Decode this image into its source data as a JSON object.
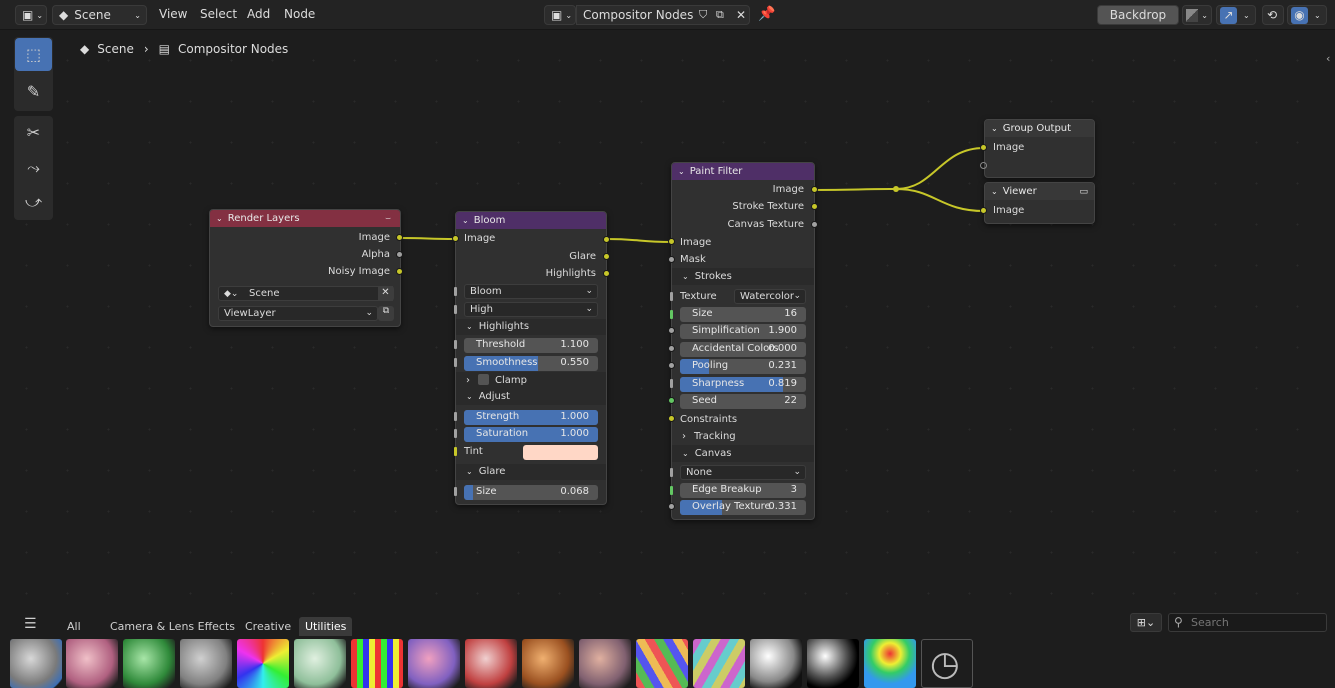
{
  "topbar": {
    "scene": "Scene",
    "menus": [
      "View",
      "Select",
      "Add",
      "Node"
    ],
    "tree_name": "Compositor Nodes",
    "backdrop": "Backdrop"
  },
  "breadcrumb": {
    "scene": "Scene",
    "tree": "Compositor Nodes"
  },
  "nodes": {
    "render_layers": {
      "title": "Render Layers",
      "outputs": [
        "Image",
        "Alpha",
        "Noisy Image"
      ],
      "scene": "Scene",
      "view_layer": "ViewLayer",
      "color": "#833042"
    },
    "bloom": {
      "title": "Bloom",
      "input": "Image",
      "outputs": [
        "Glare",
        "Highlights"
      ],
      "type": "Bloom",
      "quality": "High",
      "highlights_panel": "Highlights",
      "threshold_label": "Threshold",
      "threshold": "1.100",
      "smoothness_label": "Smoothness",
      "smoothness": "0.550",
      "smoothness_fill": 0.55,
      "clamp": "Clamp",
      "adjust_panel": "Adjust",
      "strength_label": "Strength",
      "strength": "1.000",
      "strength_fill": 1.0,
      "saturation_label": "Saturation",
      "saturation": "1.000",
      "saturation_fill": 1.0,
      "tint_label": "Tint",
      "tint_color": "#ffd7c6",
      "glare_panel": "Glare",
      "size_label": "Size",
      "size": "0.068",
      "size_fill": 0.068,
      "color": "#4f2f67"
    },
    "paint_filter": {
      "title": "Paint Filter",
      "outputs": [
        "Image",
        "Stroke Texture",
        "Canvas Texture"
      ],
      "inputs": [
        "Image",
        "Mask"
      ],
      "strokes_panel": "Strokes",
      "texture_label": "Texture",
      "texture": "Watercolor",
      "size_label": "Size",
      "size": "16",
      "simplification_label": "Simplification",
      "simplification": "1.900",
      "accidental_label": "Accidental Colors",
      "accidental": "0.000",
      "pooling_label": "Pooling",
      "pooling": "0.231",
      "pooling_fill": 0.231,
      "sharpness_label": "Sharpness",
      "sharpness": "0.819",
      "sharpness_fill": 0.819,
      "seed_label": "Seed",
      "seed": "22",
      "constraints": "Constraints",
      "tracking_panel": "Tracking",
      "canvas_panel": "Canvas",
      "canvas_type": "None",
      "edge_label": "Edge Breakup",
      "edge": "3",
      "overlay_label": "Overlay Texture",
      "overlay": "0.331",
      "overlay_fill": 0.331,
      "color": "#4f2f67"
    },
    "group_output": {
      "title": "Group Output",
      "input": "Image",
      "color": "#383838"
    },
    "viewer": {
      "title": "Viewer",
      "input": "Image",
      "color": "#383838"
    }
  },
  "asset_browser": {
    "tabs": [
      "All",
      "Camera & Lens Effects",
      "Creative",
      "Utilities"
    ],
    "active_tab": "Utilities",
    "search_placeholder": "Search"
  },
  "colors": {
    "link": "#c7c729",
    "accent": "#4772b3",
    "field": "#545454"
  }
}
